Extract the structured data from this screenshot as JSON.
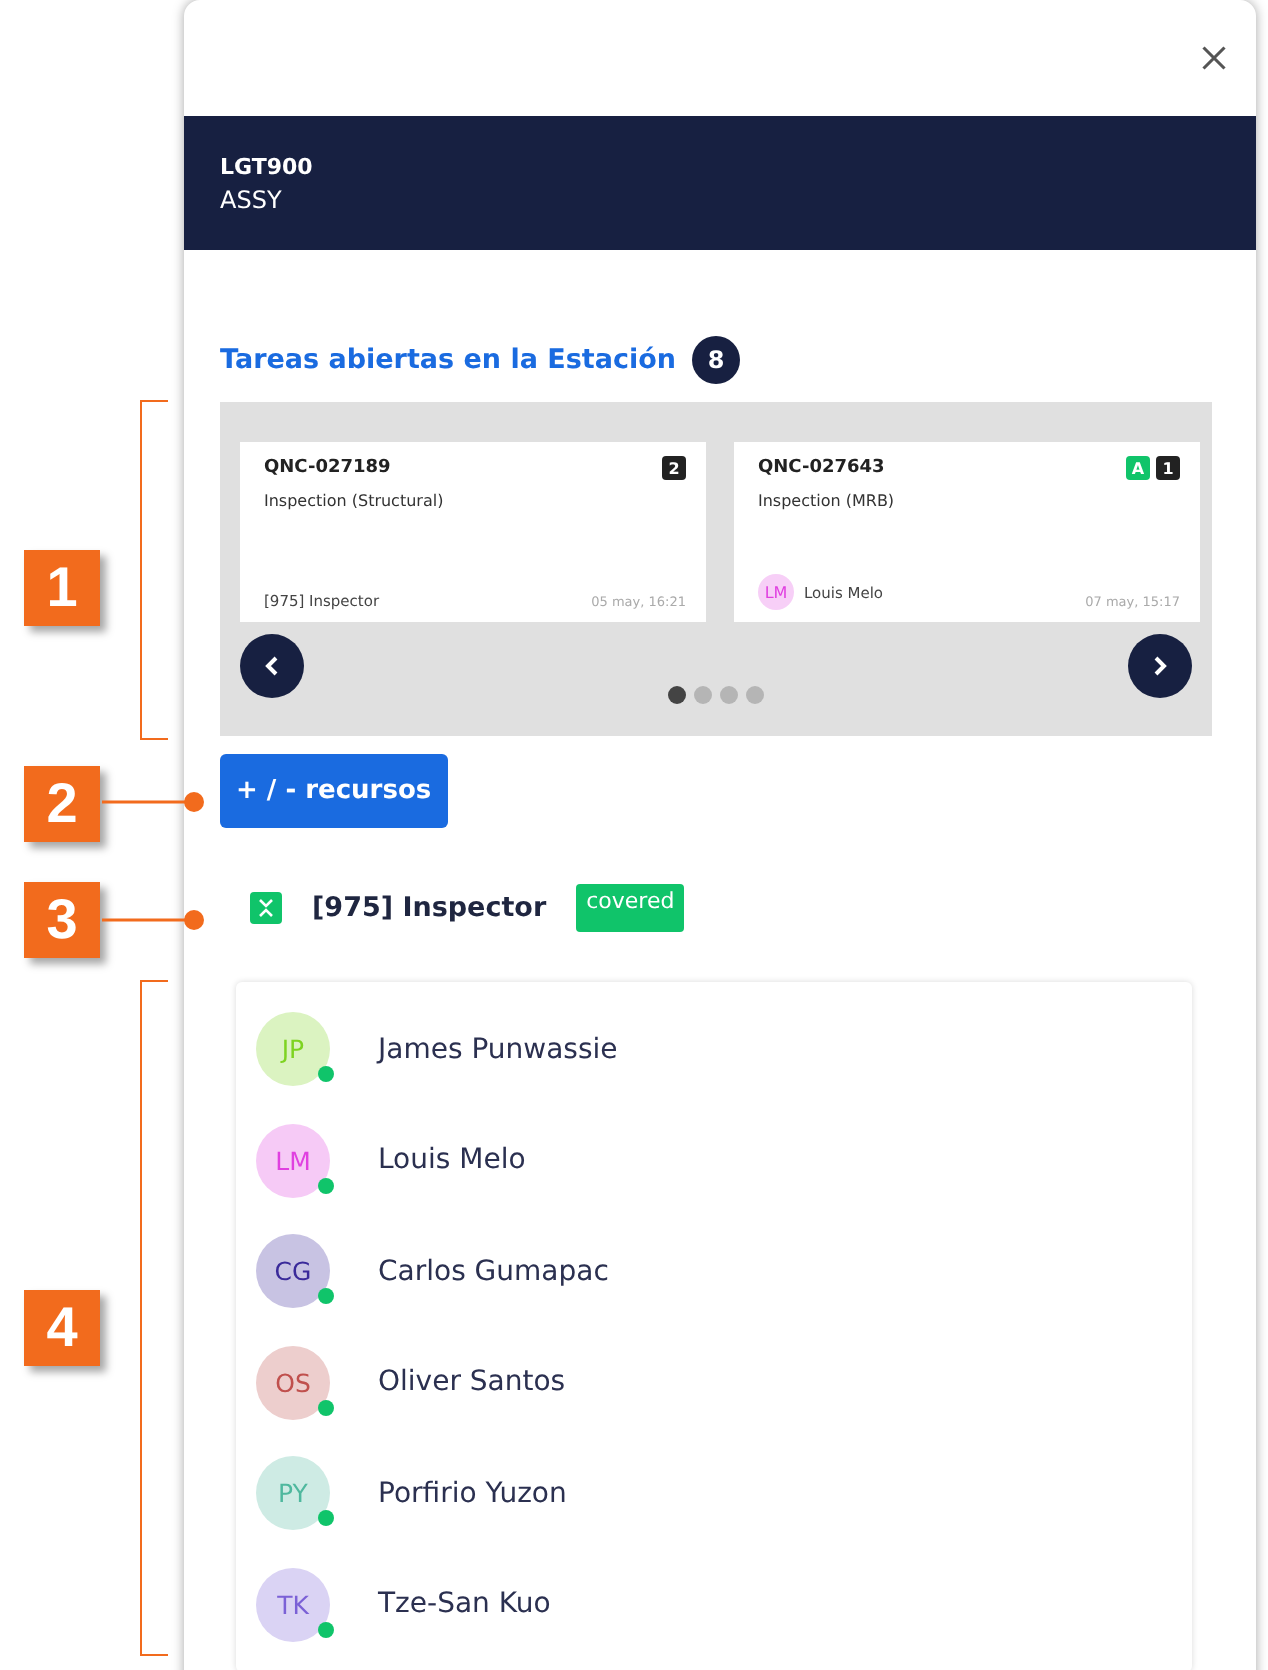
{
  "header": {
    "code": "LGT900",
    "station": "ASSY"
  },
  "tasks": {
    "title": "Tareas abiertas en la Estación",
    "count": "8",
    "cards": [
      {
        "id": "QNC-027189",
        "title": "Inspection (Structural)",
        "tags": [
          {
            "kind": "count",
            "label": "2"
          }
        ],
        "footer": {
          "kind": "role",
          "text": "[975] Inspector"
        },
        "date": "05 may, 16:21"
      },
      {
        "id": "QNC-027643",
        "title": "Inspection (MRB)",
        "tags": [
          {
            "kind": "status",
            "label": "A"
          },
          {
            "kind": "count",
            "label": "1"
          }
        ],
        "footer": {
          "kind": "user",
          "initials": "LM",
          "color": "#e040e0",
          "text": "Louis Melo"
        },
        "date": "07 may, 15:17"
      }
    ],
    "pages": [
      {
        "selected": true
      },
      {
        "selected": false
      },
      {
        "selected": false
      },
      {
        "selected": false
      }
    ]
  },
  "resources_button": "+ / - recursos",
  "role": {
    "name": "[975] Inspector",
    "status": "covered",
    "expanded": true
  },
  "people": [
    {
      "initials": "JP",
      "name": "James Punwassie",
      "color": "#7ed321",
      "online": true
    },
    {
      "initials": "LM",
      "name": "Louis Melo",
      "color": "#e040e0",
      "online": true
    },
    {
      "initials": "CG",
      "name": "Carlos Gumapac",
      "color": "#3a2a9a",
      "online": true
    },
    {
      "initials": "OS",
      "name": "Oliver Santos",
      "color": "#c0504d",
      "online": true
    },
    {
      "initials": "PY",
      "name": "Porfirio Yuzon",
      "color": "#4fb89e",
      "online": true
    },
    {
      "initials": "TK",
      "name": "Tze-San Kuo",
      "color": "#7b61d6",
      "online": true
    }
  ],
  "annotations": [
    {
      "label": "1",
      "kind": "bracket"
    },
    {
      "label": "2",
      "kind": "pointer"
    },
    {
      "label": "3",
      "kind": "pointer"
    },
    {
      "label": "4",
      "kind": "bracket"
    }
  ]
}
